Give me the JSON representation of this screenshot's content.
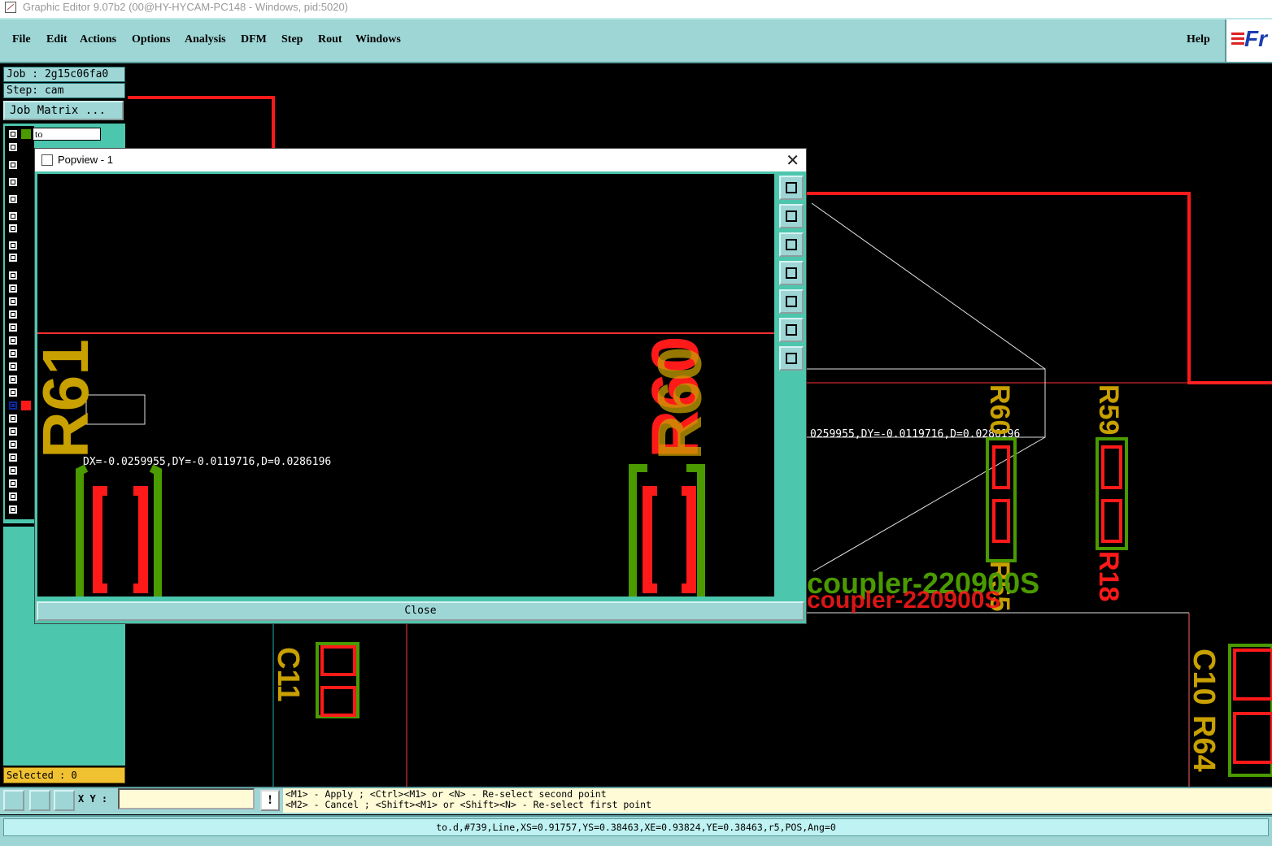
{
  "window": {
    "title": "Graphic Editor 9.07b2 (00@HY-HYCAM-PC148 - Windows, pid:5020)"
  },
  "menu": {
    "file": "File",
    "edit": "Edit",
    "actions": "Actions",
    "options": "Options",
    "analysis": "Analysis",
    "dfm": "DFM",
    "step": "Step",
    "rout": "Rout",
    "windows": "Windows",
    "help": "Help"
  },
  "logo": {
    "text": "Fr"
  },
  "left": {
    "job": "Job : 2g15c06fa0",
    "step": "Step: cam",
    "job_matrix": "Job Matrix ...",
    "layer_name": "to",
    "selected": "Selected : 0"
  },
  "popview": {
    "title": "Popview - 1",
    "measure": "DX=-0.0259955,DY=-0.0119716,D=0.0286196",
    "close_label": "Close"
  },
  "canvas": {
    "measure_partial": "0259955,DY=-0.0119716,D=0.0286196",
    "coupler_text": "coupler-220900S",
    "labels": [
      "R61",
      "R60",
      "C11",
      "R55",
      "R18",
      "C10",
      "R64"
    ]
  },
  "bottom": {
    "xy_label": "X Y :",
    "excl": "!",
    "hint_line1": "<M1> - Apply  ; <Ctrl><M1> or <N> - Re-select second point",
    "hint_line2": "<M2> - Cancel ; <Shift><M1> or <Shift><N> - Re-select first point",
    "status": "to.d,#739,Line,XS=0.91757,YS=0.38463,XE=0.93824,YE=0.38463,r5,POS,Ang=0"
  },
  "colors": {
    "teal": "#4cc6ad",
    "menu": "#9ed6d6",
    "pad_red": "#ff1a1a",
    "silk_green": "#4a9a00",
    "silk_gold": "#c8a000"
  }
}
